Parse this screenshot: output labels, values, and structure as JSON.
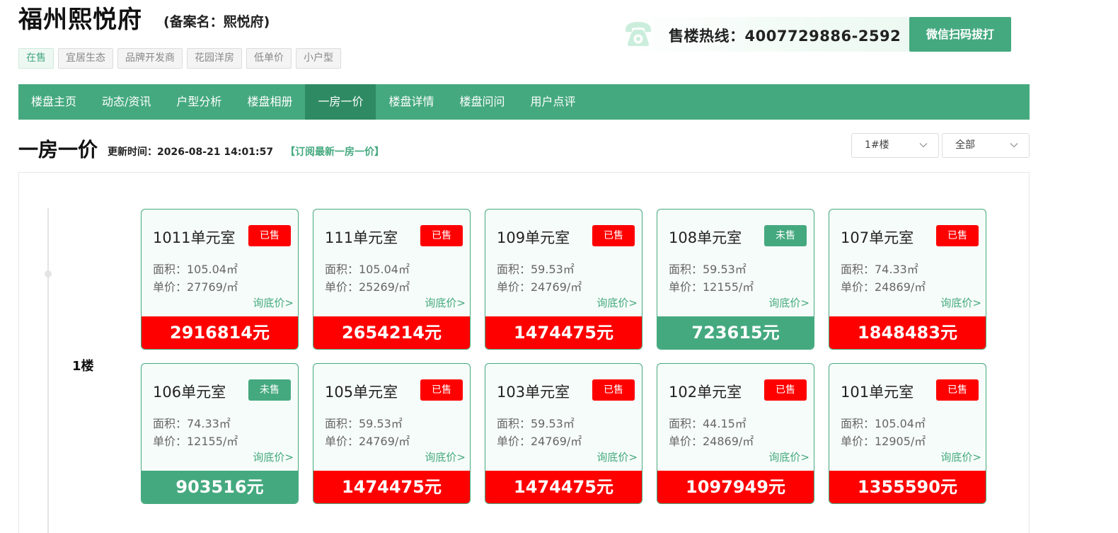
{
  "header": {
    "title": "福州熙悦府",
    "record_name": "(备案名：熙悦府)",
    "tags": [
      "在售",
      "宜居生态",
      "品牌开发商",
      "花园洋房",
      "低单价",
      "小户型"
    ],
    "hotline_label": "售楼热线：4007729886-2592",
    "wechat_button": "微信扫码拔打"
  },
  "nav": {
    "items": [
      "楼盘主页",
      "动态/资讯",
      "户型分析",
      "楼盘相册",
      "一房一价",
      "楼盘详情",
      "楼盘问问",
      "用户点评"
    ],
    "active": "一房一价"
  },
  "section": {
    "title": "一房一价",
    "update_label": "更新时间：2026-08-21 14:01:57",
    "subscribe_link": "【订阅最新一房一价】",
    "building_select": "1#楼",
    "status_select": "全部"
  },
  "floor": {
    "label": "1楼",
    "units": [
      {
        "name": "1011单元室",
        "status": "已售",
        "sold": true,
        "area": "面积：105.04㎡",
        "unit_price": "单价：27769/㎡",
        "inquire": "询底价>",
        "total": "2916814元"
      },
      {
        "name": "111单元室",
        "status": "已售",
        "sold": true,
        "area": "面积：105.04㎡",
        "unit_price": "单价：25269/㎡",
        "inquire": "询底价>",
        "total": "2654214元"
      },
      {
        "name": "109单元室",
        "status": "已售",
        "sold": true,
        "area": "面积：59.53㎡",
        "unit_price": "单价：24769/㎡",
        "inquire": "询底价>",
        "total": "1474475元"
      },
      {
        "name": "108单元室",
        "status": "未售",
        "sold": false,
        "area": "面积：59.53㎡",
        "unit_price": "单价：12155/㎡",
        "inquire": "询底价>",
        "total": "723615元"
      },
      {
        "name": "107单元室",
        "status": "已售",
        "sold": true,
        "area": "面积：74.33㎡",
        "unit_price": "单价：24869/㎡",
        "inquire": "询底价>",
        "total": "1848483元"
      },
      {
        "name": "106单元室",
        "status": "未售",
        "sold": false,
        "area": "面积：74.33㎡",
        "unit_price": "单价：12155/㎡",
        "inquire": "询底价>",
        "total": "903516元"
      },
      {
        "name": "105单元室",
        "status": "已售",
        "sold": true,
        "area": "面积：59.53㎡",
        "unit_price": "单价：24769/㎡",
        "inquire": "询底价>",
        "total": "1474475元"
      },
      {
        "name": "103单元室",
        "status": "已售",
        "sold": true,
        "area": "面积：59.53㎡",
        "unit_price": "单价：24769/㎡",
        "inquire": "询底价>",
        "total": "1474475元"
      },
      {
        "name": "102单元室",
        "status": "已售",
        "sold": true,
        "area": "面积：44.15㎡",
        "unit_price": "单价：24869/㎡",
        "inquire": "询底价>",
        "total": "1097949元"
      },
      {
        "name": "101单元室",
        "status": "已售",
        "sold": true,
        "area": "面积：105.04㎡",
        "unit_price": "单价：12905/㎡",
        "inquire": "询底价>",
        "total": "1355590元"
      }
    ]
  },
  "colors": {
    "accent": "#45a97f",
    "accent_dark": "#2e8a63",
    "sold": "#ff0000"
  }
}
